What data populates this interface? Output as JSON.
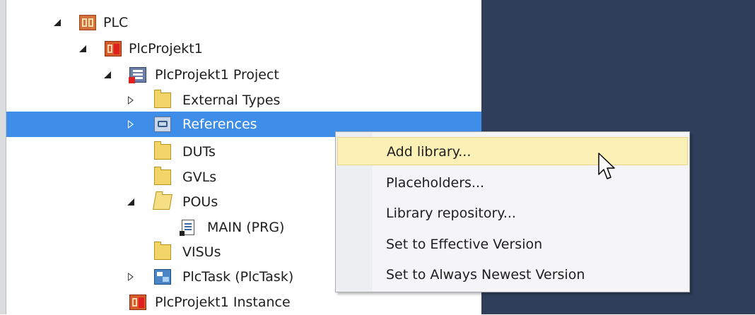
{
  "tree": {
    "items": [
      {
        "label": "PLC",
        "icon": "plc-icon",
        "expander": "expanded"
      },
      {
        "label": "PlcProjekt1",
        "icon": "plc-project-icon",
        "expander": "expanded"
      },
      {
        "label": "PlcProjekt1 Project",
        "icon": "project-file-icon",
        "expander": "expanded"
      },
      {
        "label": "External Types",
        "icon": "folder-icon",
        "expander": "collapsed"
      },
      {
        "label": "References",
        "icon": "references-icon",
        "expander": "collapsed",
        "selected": true
      },
      {
        "label": "DUTs",
        "icon": "folder-icon",
        "expander": "none"
      },
      {
        "label": "GVLs",
        "icon": "folder-icon",
        "expander": "none"
      },
      {
        "label": "POUs",
        "icon": "folder-open-icon",
        "expander": "expanded"
      },
      {
        "label": "MAIN (PRG)",
        "icon": "program-document-icon",
        "expander": "none"
      },
      {
        "label": "VISUs",
        "icon": "folder-icon",
        "expander": "none"
      },
      {
        "label": "PlcTask (PlcTask)",
        "icon": "task-icon",
        "expander": "collapsed"
      },
      {
        "label": "PlcProjekt1 Instance",
        "icon": "plc-instance-icon",
        "expander": "none"
      }
    ]
  },
  "context_menu": {
    "items": [
      {
        "label": "Add library...",
        "highlighted": true
      },
      {
        "label": "Placeholders..."
      },
      {
        "label": "Library repository..."
      },
      {
        "label": "Set to Effective Version"
      },
      {
        "label": "Set to Always Newest Version"
      }
    ]
  },
  "colors": {
    "selection": "#3e8ee9",
    "menu_highlight": "#fbf0b5",
    "dark_panel": "#2f3f5b"
  }
}
